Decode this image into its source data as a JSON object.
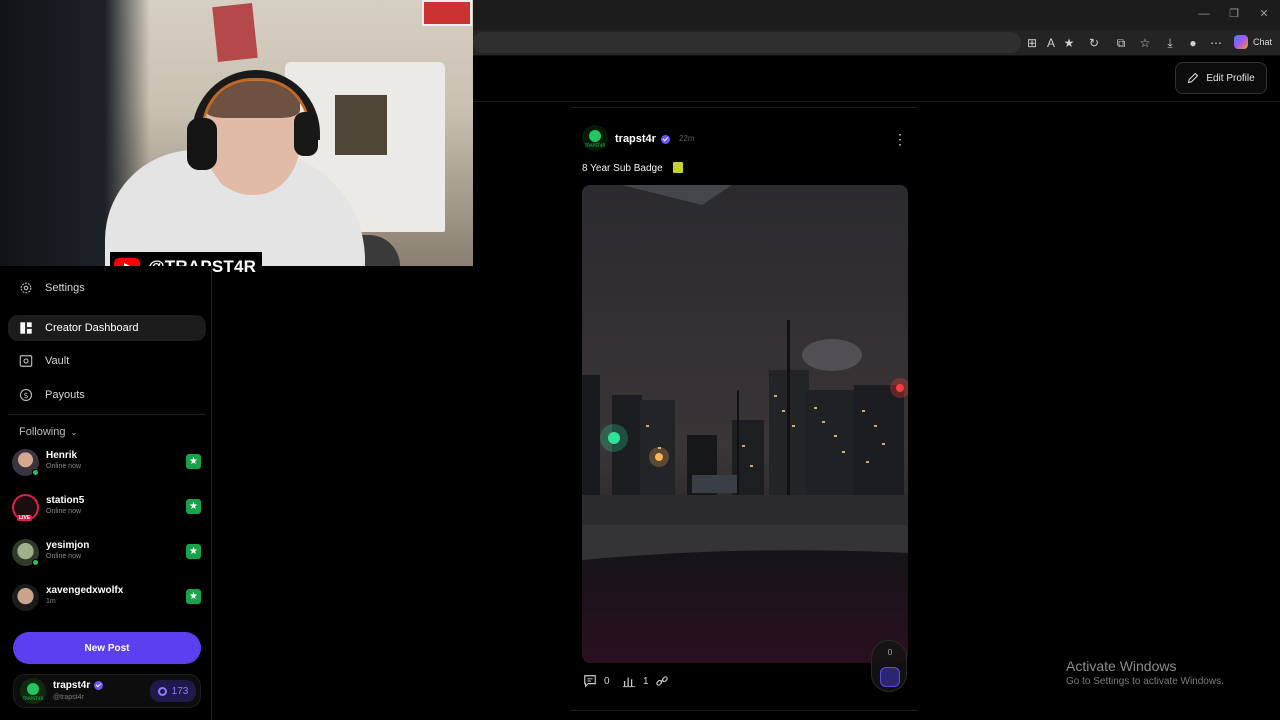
{
  "browser": {
    "chat_label": "Chat"
  },
  "header": {
    "edit_profile_label": "Edit Profile"
  },
  "webcam": {
    "handle": "@TRAPST4R"
  },
  "sidebar": {
    "nav": [
      {
        "label": "Settings",
        "icon": "gear-icon"
      },
      {
        "label": "Creator Dashboard",
        "icon": "dashboard-icon",
        "active": true
      },
      {
        "label": "Vault",
        "icon": "vault-icon"
      },
      {
        "label": "Payouts",
        "icon": "dollar-icon"
      }
    ],
    "following_label": "Following",
    "following": [
      {
        "name": "Henrik",
        "status": "Online now"
      },
      {
        "name": "station5",
        "status": "Online now",
        "badge": "LIVE"
      },
      {
        "name": "yesimjon",
        "status": "Online now"
      },
      {
        "name": "xavengedxwolfx",
        "status": "1m"
      }
    ],
    "new_post_label": "New Post",
    "me": {
      "name": "trapst4r",
      "handle": "@trapst4r",
      "coins": "173"
    }
  },
  "post": {
    "author": "trapst4r",
    "time": "22m",
    "text": "8 Year Sub Badge",
    "comments": "0",
    "views": "1",
    "counter": "0"
  },
  "watermark": {
    "title": "Activate Windows",
    "subtitle": "Go to Settings to activate Windows."
  },
  "colors": {
    "accent": "#5b3ff0",
    "online": "#22c55e",
    "star": "#16a34a"
  }
}
